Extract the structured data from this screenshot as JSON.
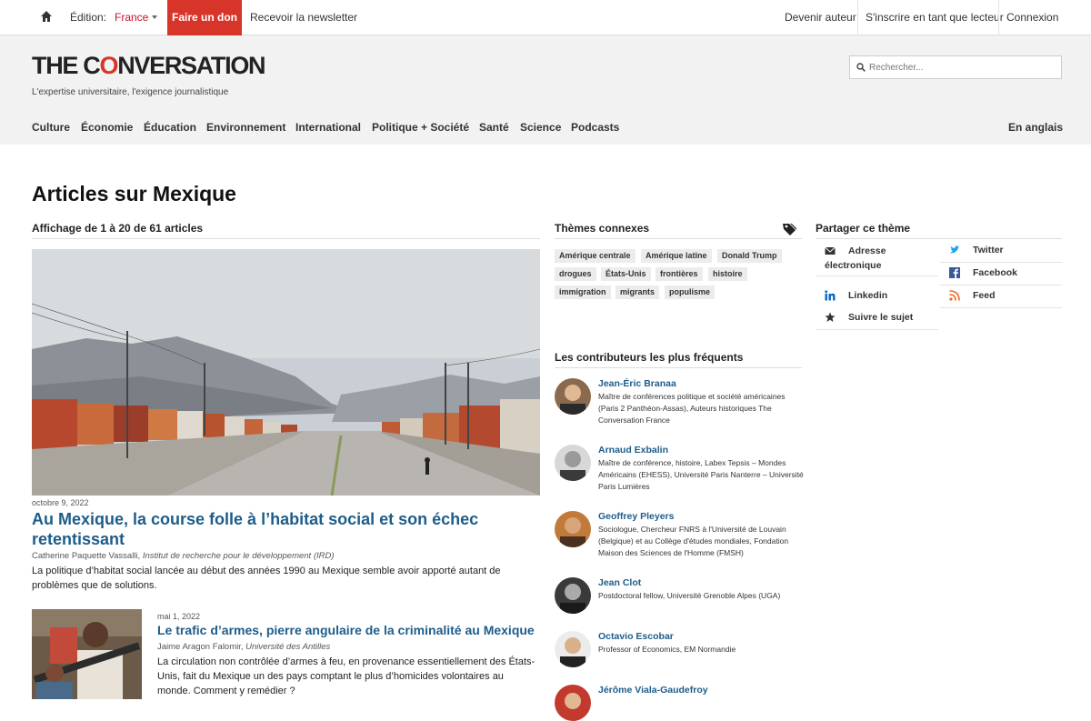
{
  "topbar": {
    "edition_label": "Édition:",
    "edition_value": "France",
    "donate": "Faire un don",
    "newsletter": "Recevoir la newsletter",
    "become_author": "Devenir auteur",
    "register_reader": "S'inscrire en tant que lecteur",
    "login": "Connexion"
  },
  "brand": {
    "name_pre": "THE C",
    "name_o": "O",
    "name_post": "NVERSATION",
    "tagline": "L'expertise universitaire, l'exigence journalistique",
    "accent": "#d8352a"
  },
  "search": {
    "placeholder": "Rechercher..."
  },
  "nav": {
    "items": [
      "Culture",
      "Économie",
      "Éducation",
      "Environnement",
      "International",
      "Politique + Société",
      "Santé",
      "Science",
      "Podcasts"
    ],
    "english": "En anglais"
  },
  "page": {
    "title": "Articles sur Mexique",
    "count_label": "Affichage de 1 à 20 de 61 articles"
  },
  "articles": [
    {
      "date": "octobre 9, 2022",
      "title": "Au Mexique, la course folle à l’habitat social et son échec retentissant",
      "author": "Catherine Paquette Vassalli",
      "institution": "Institut de recherche pour le développement (IRD)",
      "summary": "La politique d’habitat social lancée au début des années 1990 au Mexique semble avoir apporté autant de problèmes que de solutions."
    },
    {
      "date": "mai 1, 2022",
      "title": "Le trafic d’armes, pierre angulaire de la criminalité au Mexique",
      "author": "Jaime Aragon Falomir",
      "institution": "Université des Antilles",
      "summary": "La circulation non contrôlée d’armes à feu, en provenance essentiellement des États-Unis, fait du Mexique un des pays comptant le plus d’homicides volontaires au monde. Comment y remédier ?"
    }
  ],
  "themes": {
    "heading": "Thèmes connexes",
    "tags": [
      "Amérique centrale",
      "Amérique latine",
      "Donald Trump",
      "drogues",
      "États-Unis",
      "frontières",
      "histoire",
      "immigration",
      "migrants",
      "populisme"
    ]
  },
  "contributors": {
    "heading": "Les contributeurs les plus fréquents",
    "people": [
      {
        "name": "Jean-Éric Branaa",
        "affiliation": "Maître de conférences politique et société américaines (Paris 2 Panthéon-Assas), Auteurs historiques The Conversation France"
      },
      {
        "name": "Arnaud Exbalin",
        "affiliation": "Maître de conférence, histoire, Labex Tepsis – Mondes Américains (EHESS), Université Paris Nanterre – Université Paris Lumières"
      },
      {
        "name": "Geoffrey Pleyers",
        "affiliation": "Sociologue, Chercheur FNRS à l'Université de Louvain (Belgique) et au Collège d'études mondiales, Fondation Maison des Sciences de l'Homme (FMSH)"
      },
      {
        "name": "Jean Clot",
        "affiliation": "Postdoctoral fellow, Université Grenoble Alpes (UGA)"
      },
      {
        "name": "Octavio Escobar",
        "affiliation": "Professor of Economics, EM Normandie"
      },
      {
        "name": "Jérôme Viala-Gaudefroy",
        "affiliation": ""
      }
    ]
  },
  "share": {
    "heading": "Partager ce thème",
    "email": "Adresse électronique",
    "twitter": "Twitter",
    "facebook": "Facebook",
    "linkedin": "Linkedin",
    "feed": "Feed",
    "follow": "Suivre le sujet"
  }
}
